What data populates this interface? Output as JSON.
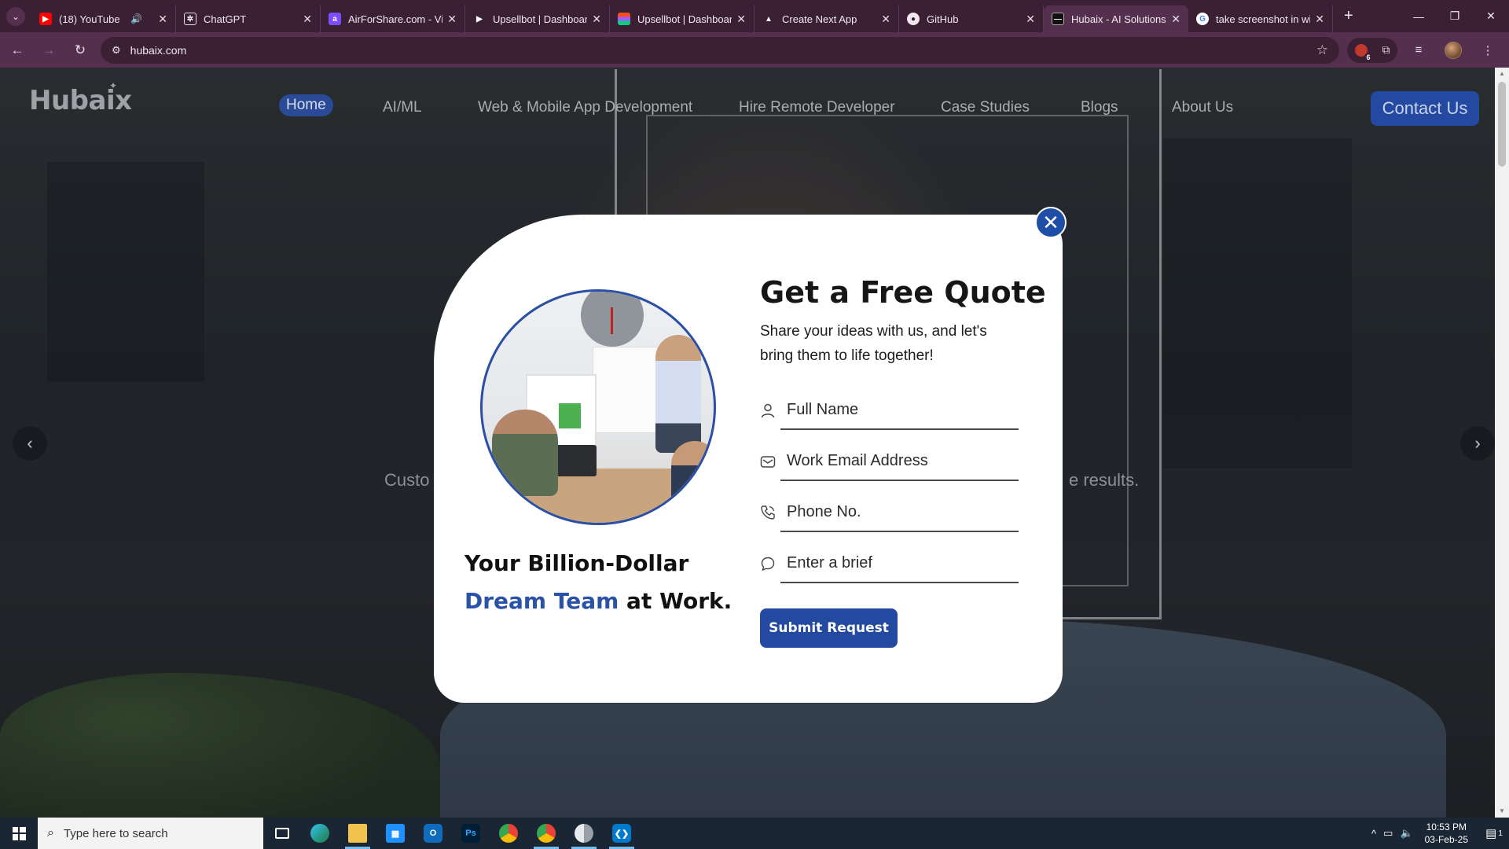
{
  "browser": {
    "tabs": [
      {
        "title": "(18) YouTube",
        "favicon_color": "#ff0000",
        "audio": true
      },
      {
        "title": "ChatGPT",
        "favicon_color": "#3a1f35"
      },
      {
        "title": "AirForShare.com - Vi",
        "favicon_color": "#7c4dff"
      },
      {
        "title": "Upsellbot | Dashboard",
        "favicon_color": "#3a1f35"
      },
      {
        "title": "Upsellbot | Dashboard",
        "favicon_color": "#f24e1e"
      },
      {
        "title": "Create Next App",
        "favicon_color": "#3a1f35"
      },
      {
        "title": "GitHub",
        "favicon_color": "#3a1f35"
      },
      {
        "title": "Hubaix - AI Solutions",
        "favicon_color": "#111111",
        "active": true
      },
      {
        "title": "take screenshot in wi",
        "favicon_color": "#4285f4"
      }
    ],
    "url": "hubaix.com",
    "extension_badge": "6"
  },
  "site": {
    "logo": "Hubaix",
    "nav": [
      "Home",
      "AI/ML",
      "Web & Mobile App Development",
      "Hire Remote Developer",
      "Case Studies",
      "Blogs",
      "About Us"
    ],
    "contact_label": "Contact Us",
    "hero_left": "Custo",
    "hero_right": "e results."
  },
  "modal": {
    "close_glyph": "✕",
    "tagline_line1": "Your Billion-Dollar",
    "tagline_accent": "Dream Team",
    "tagline_rest": " at Work.",
    "title": "Get a Free Quote",
    "subtitle": "Share your ideas with us, and let's bring them to life together!",
    "fields": [
      {
        "placeholder": "Full Name",
        "icon": "user-icon"
      },
      {
        "placeholder": "Work Email Address",
        "icon": "mail-icon"
      },
      {
        "placeholder": "Phone No.",
        "icon": "phone-icon"
      },
      {
        "placeholder": "Enter a brief",
        "icon": "chat-icon"
      }
    ],
    "submit_label": "Submit Request",
    "accent_color": "#234aa0"
  },
  "taskbar": {
    "search_placeholder": "Type here to search",
    "time": "10:53 PM",
    "date": "03-Feb-25",
    "notification_count": "1"
  }
}
